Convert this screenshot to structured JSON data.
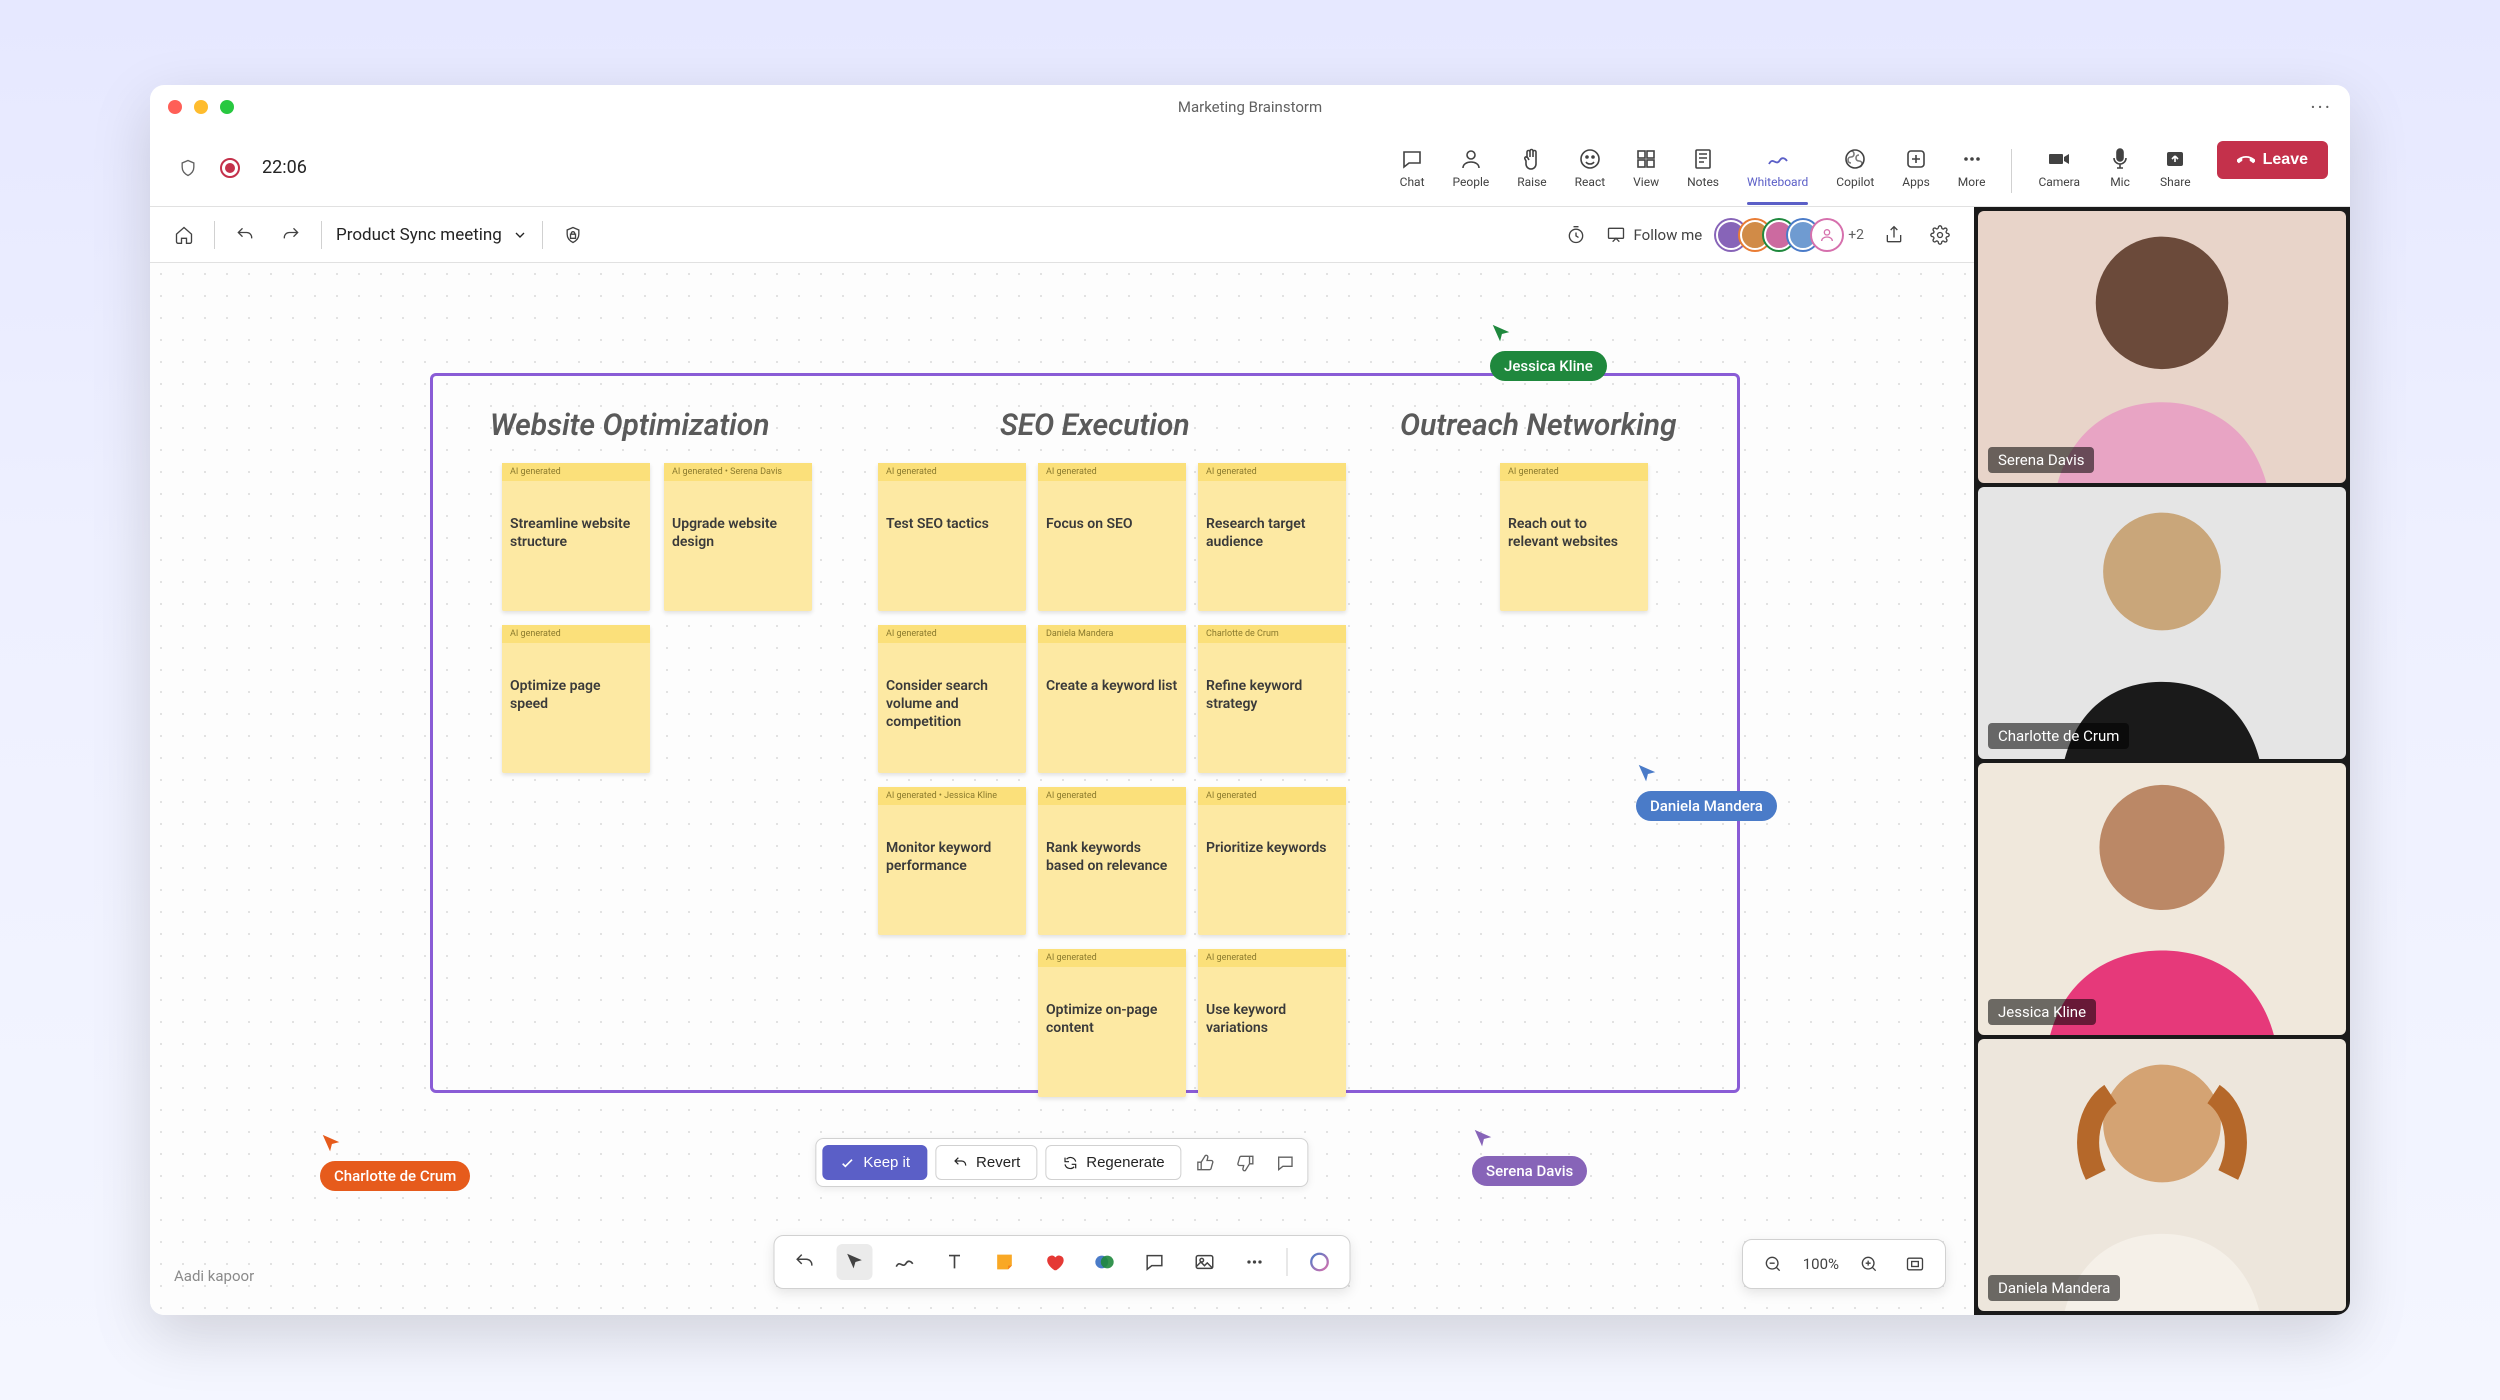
{
  "window_title": "Marketing Brainstorm",
  "timer": "22:06",
  "toolbar": {
    "chat": "Chat",
    "people": "People",
    "raise": "Raise",
    "react": "React",
    "view": "View",
    "notes": "Notes",
    "whiteboard": "Whiteboard",
    "copilot": "Copilot",
    "apps": "Apps",
    "more": "More",
    "camera": "Camera",
    "mic": "Mic",
    "share": "Share",
    "leave": "Leave"
  },
  "wb": {
    "title": "Product Sync meeting",
    "follow_me": "Follow me",
    "more_avatars": "+2"
  },
  "columns": {
    "a": "Website Optimization",
    "b": "SEO Execution",
    "c": "Outreach Networking"
  },
  "tags": {
    "ai": "AI generated",
    "ai_serena": "AI generated • Serena Davis",
    "ai_jessica": "AI generated • Jessica Kline",
    "daniela": "Daniela Mandera",
    "charlotte": "Charlotte de Crum"
  },
  "notes": {
    "a1": "Streamline website structure",
    "a2": "Upgrade website design",
    "a3": "Optimize page speed",
    "b1": "Test SEO tactics",
    "b2": "Focus on SEO",
    "b3": "Research target audience",
    "b4": "Consider search volume and competition",
    "b5": "Create a keyword list",
    "b6": "Refine keyword strategy",
    "b7": "Monitor keyword performance",
    "b8": "Rank keywords based on relevance",
    "b9": "Prioritize keywords",
    "b10": "Optimize on-page content",
    "b11": "Use keyword variations",
    "c1": "Reach out to relevant websites"
  },
  "cursors": {
    "jessica": "Jessica Kline",
    "daniela": "Daniela Mandera",
    "charlotte": "Charlotte de Crum",
    "serena": "Serena Davis"
  },
  "ai_bar": {
    "keep": "Keep it",
    "revert": "Revert",
    "regenerate": "Regenerate"
  },
  "zoom": "100%",
  "owner": "Aadi kapoor",
  "video": {
    "p1": "Serena Davis",
    "p2": "Charlotte de Crum",
    "p3": "Jessica Kline",
    "p4": "Daniela Mandera"
  }
}
